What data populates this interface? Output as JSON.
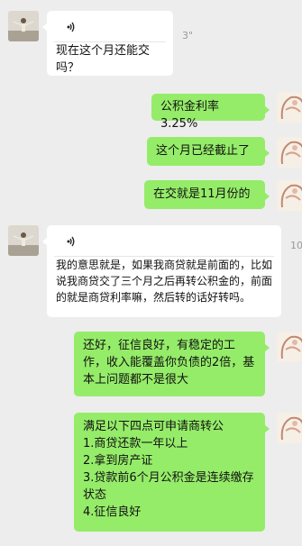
{
  "messages": [
    {
      "side": "left",
      "type": "voice_transcript",
      "duration": "3\"",
      "text": "现在这个月还能交吗？"
    },
    {
      "side": "right",
      "text": "公积金利率3.25%"
    },
    {
      "side": "right",
      "text": "这个月已经截止了"
    },
    {
      "side": "right",
      "text": "在交就是11月份的"
    },
    {
      "side": "left",
      "type": "voice_transcript",
      "duration": "10",
      "text": "我的意思就是，如果我商贷就是前面的，比如说我商贷交了三个月之后再转公积金的，前面的就是商贷利率嘛，然后转的话好转吗。"
    },
    {
      "side": "right",
      "text": "还好，征信良好，有稳定的工作，收入能覆盖你负债的2倍，基本上问题都不是很大"
    },
    {
      "side": "right",
      "text": "满足以下四点可申请商转公\n1.商贷还款一年以上\n2.拿到房产证\n3.贷款前6个月公积金是连续缴存状态\n4.征信良好"
    }
  ],
  "icons": {
    "voice": "voice-wave-icon"
  },
  "colors": {
    "background": "#ededed",
    "sent_bubble": "#95ec69",
    "received_bubble": "#ffffff"
  }
}
